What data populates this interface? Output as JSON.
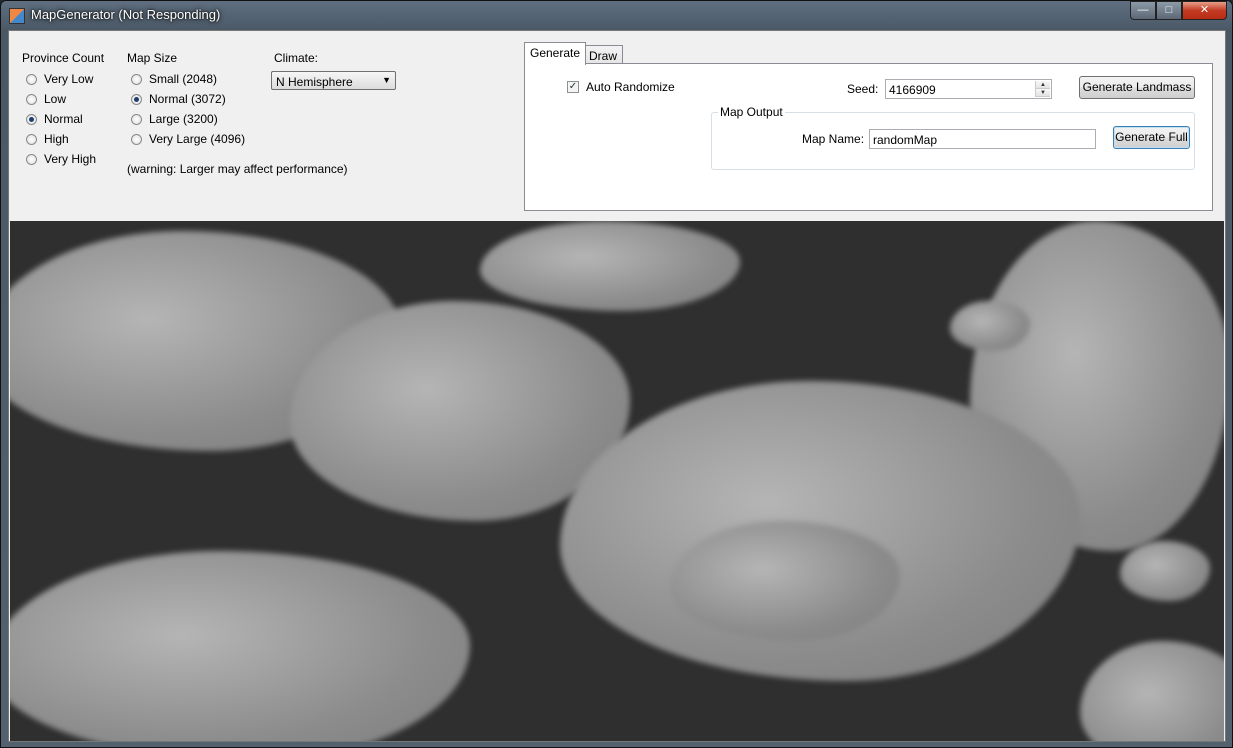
{
  "window": {
    "title": "MapGenerator (Not Responding)"
  },
  "province_count": {
    "label": "Province Count",
    "options": [
      "Very Low",
      "Low",
      "Normal",
      "High",
      "Very High"
    ],
    "selected": "Normal"
  },
  "map_size": {
    "label": "Map Size",
    "options": [
      "Small (2048)",
      "Normal (3072)",
      "Large (3200)",
      "Very Large (4096)"
    ],
    "selected": "Normal (3072)",
    "warning": "(warning: Larger may affect performance)"
  },
  "climate": {
    "label": "Climate:",
    "value": "N Hemisphere"
  },
  "tabs": [
    "Generate",
    "Draw"
  ],
  "active_tab": "Generate",
  "generate": {
    "auto_randomize_label": "Auto Randomize",
    "auto_randomize_checked": true,
    "seed_label": "Seed:",
    "seed_value": "4166909",
    "generate_landmass_label": "Generate Landmass",
    "map_output": {
      "label": "Map Output",
      "map_name_label": "Map Name:",
      "map_name_value": "randomMap",
      "generate_full_label": "Generate Full"
    }
  }
}
